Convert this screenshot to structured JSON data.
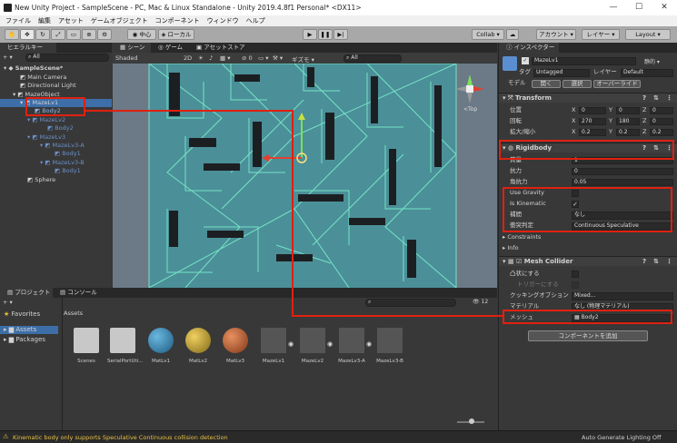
{
  "window": {
    "title": "New Unity Project - SampleScene - PC, Mac & Linux Standalone - Unity 2019.4.8f1 Personal* <DX11>",
    "minimize": "—",
    "maximize": "☐",
    "close": "✕"
  },
  "menu": [
    "ファイル",
    "編集",
    "アセット",
    "ゲームオブジェクト",
    "コンポーネント",
    "ウィンドウ",
    "ヘルプ"
  ],
  "toolbar": {
    "center": "中心",
    "local": "ローカル",
    "collab": "Collab ▾",
    "account": "アカウント ▾",
    "layers": "レイヤー ▾",
    "layout": "Layout ▾"
  },
  "hierarchy": {
    "tab": "ヒエラルキー",
    "create": "+ ▾",
    "search": "All",
    "items": [
      {
        "label": "SampleScene*",
        "indent": 0
      },
      {
        "label": "Main Camera",
        "indent": 1
      },
      {
        "label": "Directional Light",
        "indent": 1
      },
      {
        "label": "MazeObject",
        "indent": 1
      },
      {
        "label": "MazeLv1",
        "indent": 2
      },
      {
        "label": "Body2",
        "indent": 3
      },
      {
        "label": "MazeLv2",
        "indent": 2
      },
      {
        "label": "Body2",
        "indent": 3
      },
      {
        "label": "MazeLv3",
        "indent": 2
      },
      {
        "label": "MazeLv3-A",
        "indent": 3
      },
      {
        "label": "Body1",
        "indent": 4
      },
      {
        "label": "MazeLv3-B",
        "indent": 3
      },
      {
        "label": "Body1",
        "indent": 4
      },
      {
        "label": "Sphere",
        "indent": 1
      }
    ]
  },
  "scene": {
    "tab_scene": "シーン",
    "tab_game": "ゲーム",
    "tab_store": "アセットストア",
    "shading": "Shaded",
    "mode2d": "2D",
    "gizmos": "ギズモ ▾",
    "search": "All",
    "persp": "<Top"
  },
  "project": {
    "tab_project": "プロジェクト",
    "tab_console": "コンソール",
    "create": "+ ▾",
    "favorites": "Favorites",
    "assets": "Assets",
    "packages": "Packages",
    "breadcrumb": "Assets",
    "count": "12",
    "items": [
      "Scenes",
      "SerialPortUti...",
      "MatLv1",
      "MatLv2",
      "MatLv3",
      "MazeLv1",
      "MazeLv2",
      "MazeLv3-A",
      "MazeLv3-B"
    ]
  },
  "inspector": {
    "tab": "インスペクター",
    "object_name": "MazeLv1",
    "static": "静的 ▾",
    "tag_label": "タグ",
    "tag_value": "Untagged",
    "layer_label": "レイヤー",
    "layer_value": "Default",
    "model_label": "モデル",
    "open": "開く",
    "select": "選択",
    "overrides": "オーバーライド",
    "transform": {
      "title": "Transform",
      "rows": [
        {
          "label": "位置",
          "x": "0",
          "y": "0",
          "z": "0"
        },
        {
          "label": "回転",
          "x": "270",
          "y": "180",
          "z": "0"
        },
        {
          "label": "拡大/縮小",
          "x": "0.2",
          "y": "0.2",
          "z": "0.2"
        }
      ]
    },
    "rigidbody": {
      "title": "Rigidbody",
      "mass_label": "質量",
      "mass": "1",
      "drag_label": "抗力",
      "drag": "0",
      "angdrag_label": "角抗力",
      "angdrag": "0.05",
      "gravity_label": "Use Gravity",
      "kinematic_label": "Is Kinematic",
      "interp_label": "補間",
      "interp": "なし",
      "collision_label": "衝突判定",
      "collision": "Continuous Speculative",
      "constraints": "Constraints",
      "info": "Info"
    },
    "mesh_collider": {
      "title": "Mesh Collider",
      "convex": "凸状にする",
      "trigger": "トリガーにする",
      "cooking_label": "クッキングオプション",
      "cooking": "Mixed...",
      "material_label": "マテリアル",
      "material": "なし (物理マテリアル)",
      "mesh_label": "メッシュ",
      "mesh": "Body2"
    },
    "add_component": "コンポーネントを追加"
  },
  "status": {
    "warning": "Kinematic body only supports Speculative Continuous collision detection",
    "lighting": "Auto Generate Lighting Off"
  },
  "colors": {
    "accent_red": "#e02010",
    "maze_wall": "#4fb8b8",
    "highlight": "#3d6ea8"
  }
}
